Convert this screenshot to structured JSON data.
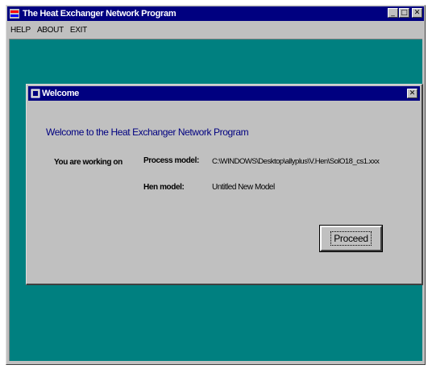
{
  "app": {
    "title": "The Heat Exchanger Network Program",
    "icon": "app-icon",
    "window_buttons": [
      "_",
      "□",
      "✕"
    ]
  },
  "menu": {
    "items": [
      "HELP",
      "ABOUT",
      "EXIT"
    ]
  },
  "dialog": {
    "title": "Welcome",
    "close_glyph": "✕",
    "welcome_message": "Welcome to the Heat Exchanger Network Program",
    "working_label": "You are working on",
    "process_model_label": "Process model:",
    "process_model_value": "C:\\WINDOWS\\Desktop\\allyplus\\V.Hen\\SolO18_cs1.xxx",
    "hen_model_label": "Hen model:",
    "hen_model_value": "Untitled New Model",
    "proceed_label": "Proceed"
  },
  "colors": {
    "titlebar": "#000080",
    "client_bg": "#008080",
    "face": "#c0c0c0",
    "welcome_text": "#000080"
  }
}
